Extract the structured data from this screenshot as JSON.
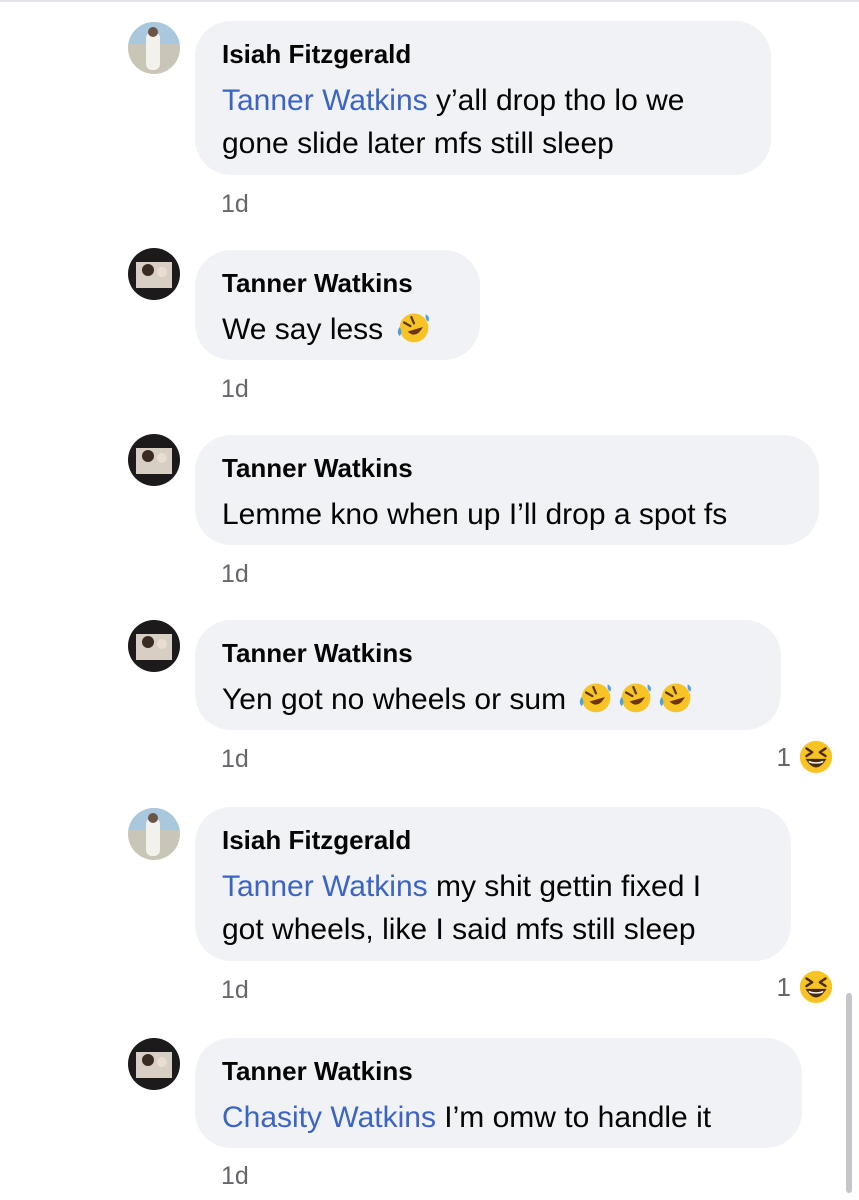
{
  "comments": [
    {
      "author": "Isiah Fitzgerald",
      "line1_mention": "Tanner Watkins",
      "line1_text": " y’all drop tho lo we",
      "line2_text": "gone slide later mfs still sleep",
      "time": "1d",
      "avatar_icon": "profile-photo-light"
    },
    {
      "author": "Tanner Watkins",
      "text": "We say less ",
      "emojis": [
        "rolling-on-floor-laughing-emoji"
      ],
      "time": "1d",
      "avatar_icon": "profile-photo-dark"
    },
    {
      "author": "Tanner Watkins",
      "text": "Lemme kno when up I’ll drop a spot fs",
      "time": "1d",
      "avatar_icon": "profile-photo-dark"
    },
    {
      "author": "Tanner Watkins",
      "text": "Yen got no wheels or sum ",
      "emojis": [
        "rolling-on-floor-laughing-emoji",
        "rolling-on-floor-laughing-emoji",
        "rolling-on-floor-laughing-emoji"
      ],
      "time": "1d",
      "reaction_count": "1",
      "reaction_icon": "laughing-squint-emoji",
      "avatar_icon": "profile-photo-dark"
    },
    {
      "author": "Isiah Fitzgerald",
      "line1_mention": "Tanner Watkins",
      "line1_text": " my shit gettin fixed I",
      "line2_text": "got wheels, like I said mfs still sleep",
      "time": "1d",
      "reaction_count": "1",
      "reaction_icon": "laughing-squint-emoji",
      "avatar_icon": "profile-photo-light"
    },
    {
      "author": "Tanner Watkins",
      "line1_mention": "Chasity Watkins",
      "line1_text": " I’m omw to handle it",
      "time": "1d",
      "avatar_icon": "profile-photo-dark"
    }
  ],
  "colors": {
    "bubble": "#f0f2f5",
    "mention": "#3b64c4",
    "secondary_text": "#65676b",
    "emoji": "#f7c325"
  }
}
